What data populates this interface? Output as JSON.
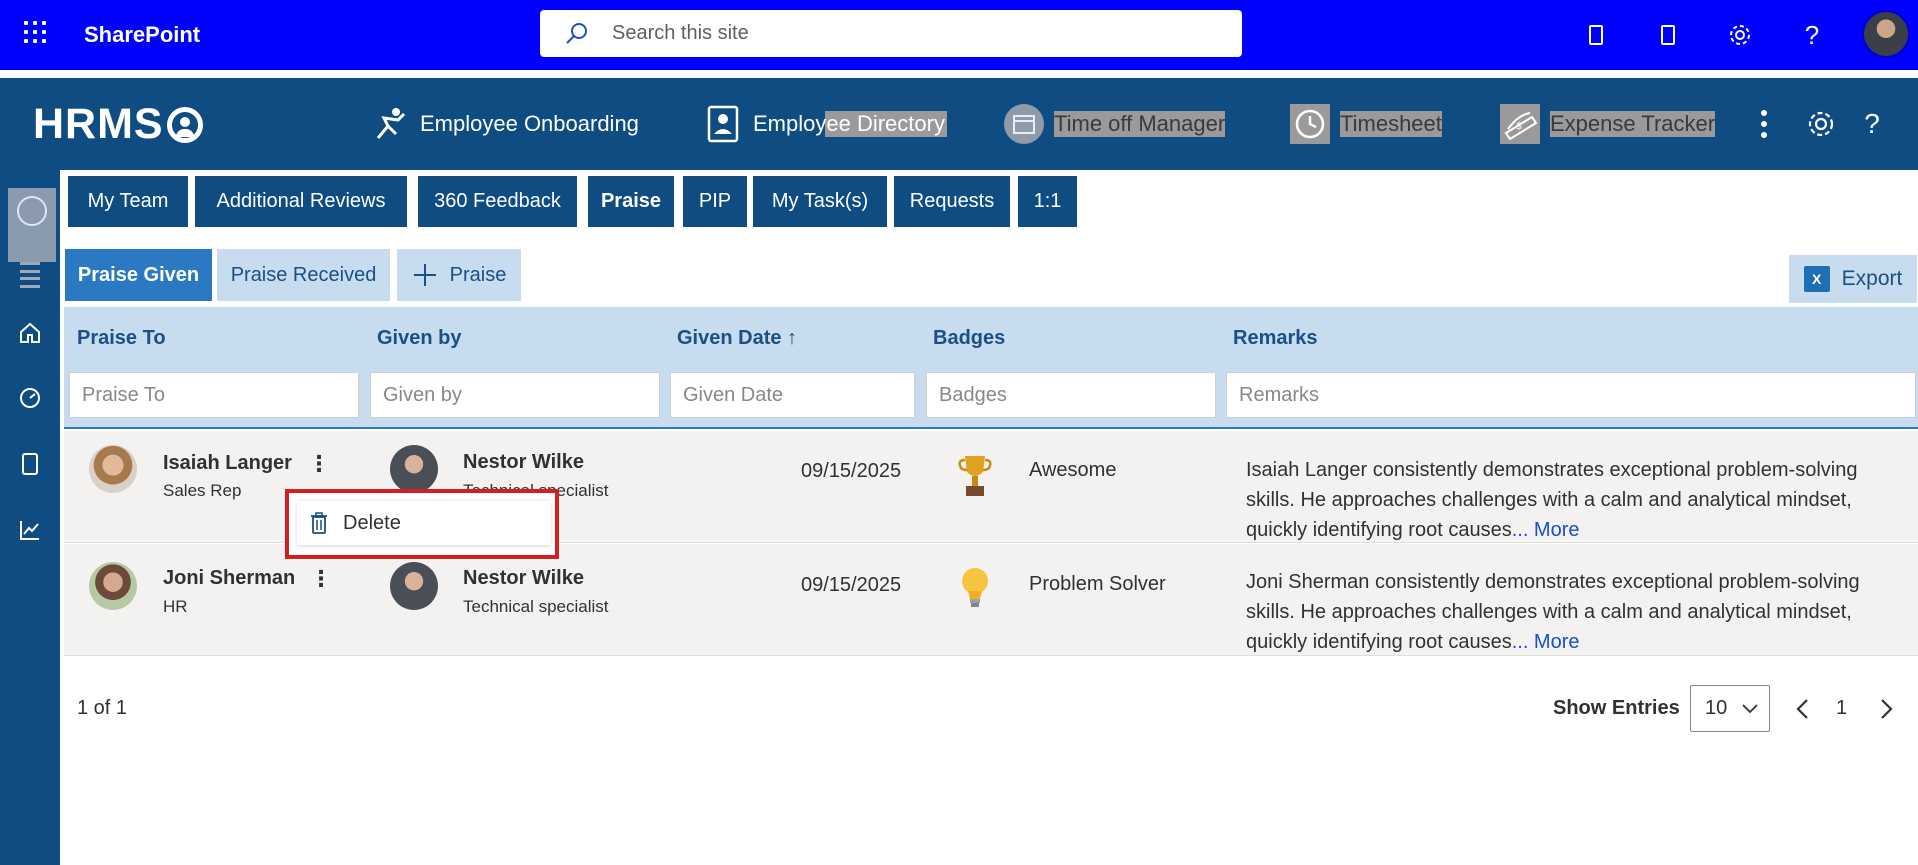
{
  "topbar": {
    "app_name": "SharePoint",
    "search_placeholder": "Search this site"
  },
  "app": {
    "logo": "HRMS",
    "nav": [
      {
        "label": "Employee Onboarding",
        "icon": "onboarding-icon"
      },
      {
        "label": "Employee Directory",
        "icon": "directory-icon"
      },
      {
        "label": "Time off Manager",
        "icon": "calendar-icon"
      },
      {
        "label": "Timesheet",
        "icon": "clock-icon"
      },
      {
        "label": "Expense Tracker",
        "icon": "expense-icon"
      }
    ]
  },
  "tabs": [
    "My Team",
    "Additional Reviews",
    "360 Feedback",
    "Praise",
    "PIP",
    "My Task(s)",
    "Requests",
    "1:1"
  ],
  "active_tab": "Praise",
  "subtabs": {
    "given": "Praise Given",
    "received": "Praise Received",
    "add": "Praise",
    "export": "Export"
  },
  "table": {
    "headers": {
      "praise_to": "Praise To",
      "given_by": "Given by",
      "given_date": "Given Date ↑",
      "badges": "Badges",
      "remarks": "Remarks"
    },
    "filters": {
      "praise_to": "Praise To",
      "given_by": "Given by",
      "given_date": "Given Date",
      "badges": "Badges",
      "remarks": "Remarks"
    },
    "rows": [
      {
        "to_name": "Isaiah Langer",
        "to_role": "Sales Rep",
        "by_name": "Nestor Wilke",
        "by_role": "Technical specialist",
        "date": "09/15/2025",
        "badge": "Awesome",
        "badge_icon": "trophy-icon",
        "remark": "Isaiah Langer consistently demonstrates exceptional problem-solving skills. He approaches challenges with a calm and analytical mindset, quickly identifying root causes",
        "more": "... More"
      },
      {
        "to_name": "Joni Sherman",
        "to_role": "HR",
        "by_name": "Nestor Wilke",
        "by_role": "Technical specialist",
        "date": "09/15/2025",
        "badge": "Problem Solver",
        "badge_icon": "lightbulb-icon",
        "remark": "Joni Sherman consistently demonstrates exceptional problem-solving skills. He approaches challenges with a calm and analytical mindset, quickly identifying root causes",
        "more": "... More"
      }
    ]
  },
  "context_menu": {
    "delete": "Delete"
  },
  "footer": {
    "page_info": "1 of 1",
    "show_entries": "Show Entries",
    "entries_value": "10",
    "current_page": "1"
  },
  "colors": {
    "sharepoint_bar": "#0000ff",
    "app_primary": "#0f4c81",
    "accent_blue": "#2b79c2",
    "light_blue": "#c7dcee",
    "highlight_box": "#d21f1f"
  }
}
